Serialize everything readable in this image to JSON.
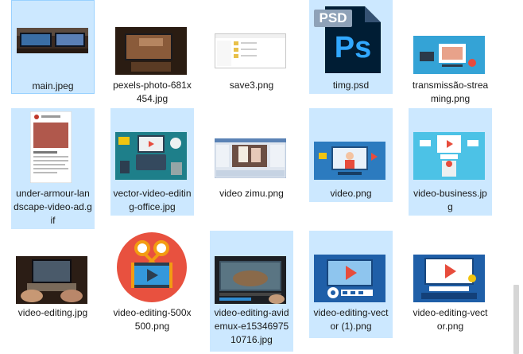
{
  "files": [
    {
      "name": "main.jpeg",
      "selected": true,
      "thumb": "monitors-photo-icon"
    },
    {
      "name": "pexels-photo-681x454.jpg",
      "selected": false,
      "thumb": "editing-desk-photo-icon"
    },
    {
      "name": "save3.png",
      "selected": false,
      "thumb": "explorer-window-icon"
    },
    {
      "name": "timg.psd",
      "selected": true,
      "thumb": "photoshop-file-icon",
      "badge": "PSD",
      "logo": "Ps"
    },
    {
      "name": "transmissão-streaming.png",
      "selected": true,
      "thumb": "streaming-illustration-icon"
    },
    {
      "name": "under-armour-landscape-video-ad.gif",
      "selected": true,
      "thumb": "social-post-icon"
    },
    {
      "name": "vector-video-editing-office.jpg",
      "selected": true,
      "thumb": "desk-vector-icon"
    },
    {
      "name": "video zimu.png",
      "selected": false,
      "thumb": "video-editor-screenshot-icon"
    },
    {
      "name": "video.png",
      "selected": true,
      "thumb": "video-presenter-icon"
    },
    {
      "name": "video-business.jpg",
      "selected": true,
      "thumb": "video-business-icon"
    },
    {
      "name": "video-editing.jpg",
      "selected": false,
      "thumb": "laptop-editing-photo-icon"
    },
    {
      "name": "video-editing-500x500.png",
      "selected": false,
      "thumb": "film-clapper-icon"
    },
    {
      "name": "video-editing-avidemux-e1534697510716.jpg",
      "selected": true,
      "thumb": "avidemux-screenshot-icon"
    },
    {
      "name": "video-editing-vector (1).png",
      "selected": true,
      "thumb": "editing-vector-icon-1"
    },
    {
      "name": "video-editing-vector.png",
      "selected": true,
      "thumb": "editing-vector-icon-2"
    }
  ],
  "colors": {
    "selection": "#cce8ff",
    "focus_border": "#99d1ff",
    "ps_blue": "#001d34",
    "ps_accent": "#31a8ff"
  }
}
